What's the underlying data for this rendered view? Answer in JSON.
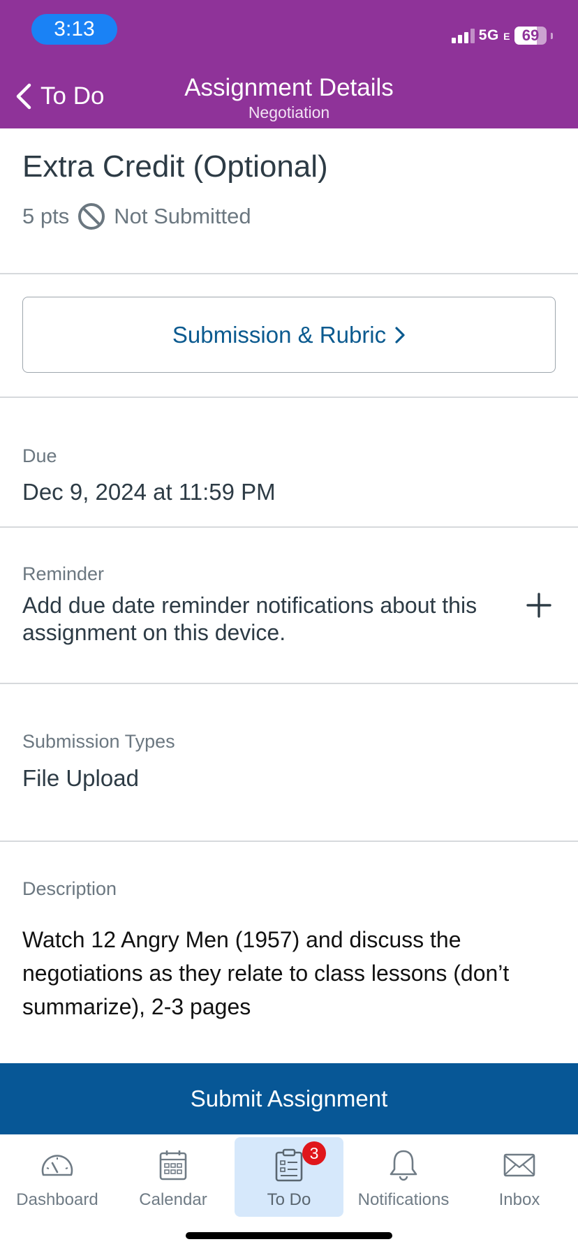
{
  "status_bar": {
    "time": "3:13",
    "network": "5G",
    "network_suffix": "E",
    "battery": "69"
  },
  "header": {
    "back_label": "To Do",
    "title": "Assignment Details",
    "subtitle": "Negotiation"
  },
  "assignment": {
    "title": "Extra Credit (Optional)",
    "points": "5 pts",
    "status": "Not Submitted"
  },
  "rubric_button": {
    "label": "Submission & Rubric"
  },
  "due": {
    "label": "Due",
    "value": "Dec 9, 2024 at 11:59 PM"
  },
  "reminder": {
    "label": "Reminder",
    "text": "Add due date reminder notifications about this assignment on this device."
  },
  "submission_types": {
    "label": "Submission Types",
    "value": "File Upload"
  },
  "description": {
    "label": "Description",
    "text": "Watch 12 Angry Men (1957) and discuss the negotiations as they relate to class lessons (don’t summarize), 2-3 pages"
  },
  "submit_button": {
    "label": "Submit Assignment"
  },
  "tabbar": {
    "items": [
      {
        "label": "Dashboard",
        "icon": "dashboard-icon"
      },
      {
        "label": "Calendar",
        "icon": "calendar-icon"
      },
      {
        "label": "To Do",
        "icon": "todo-icon",
        "badge": "3",
        "active": true
      },
      {
        "label": "Notifications",
        "icon": "bell-icon"
      },
      {
        "label": "Inbox",
        "icon": "envelope-icon"
      }
    ]
  },
  "colors": {
    "header_bg": "#8f3399",
    "time_pill": "#1a82f5",
    "link": "#0b5a8f",
    "submit_bg": "#075796",
    "badge": "#e0161b",
    "active_tab_bg": "#d6e8fb"
  }
}
